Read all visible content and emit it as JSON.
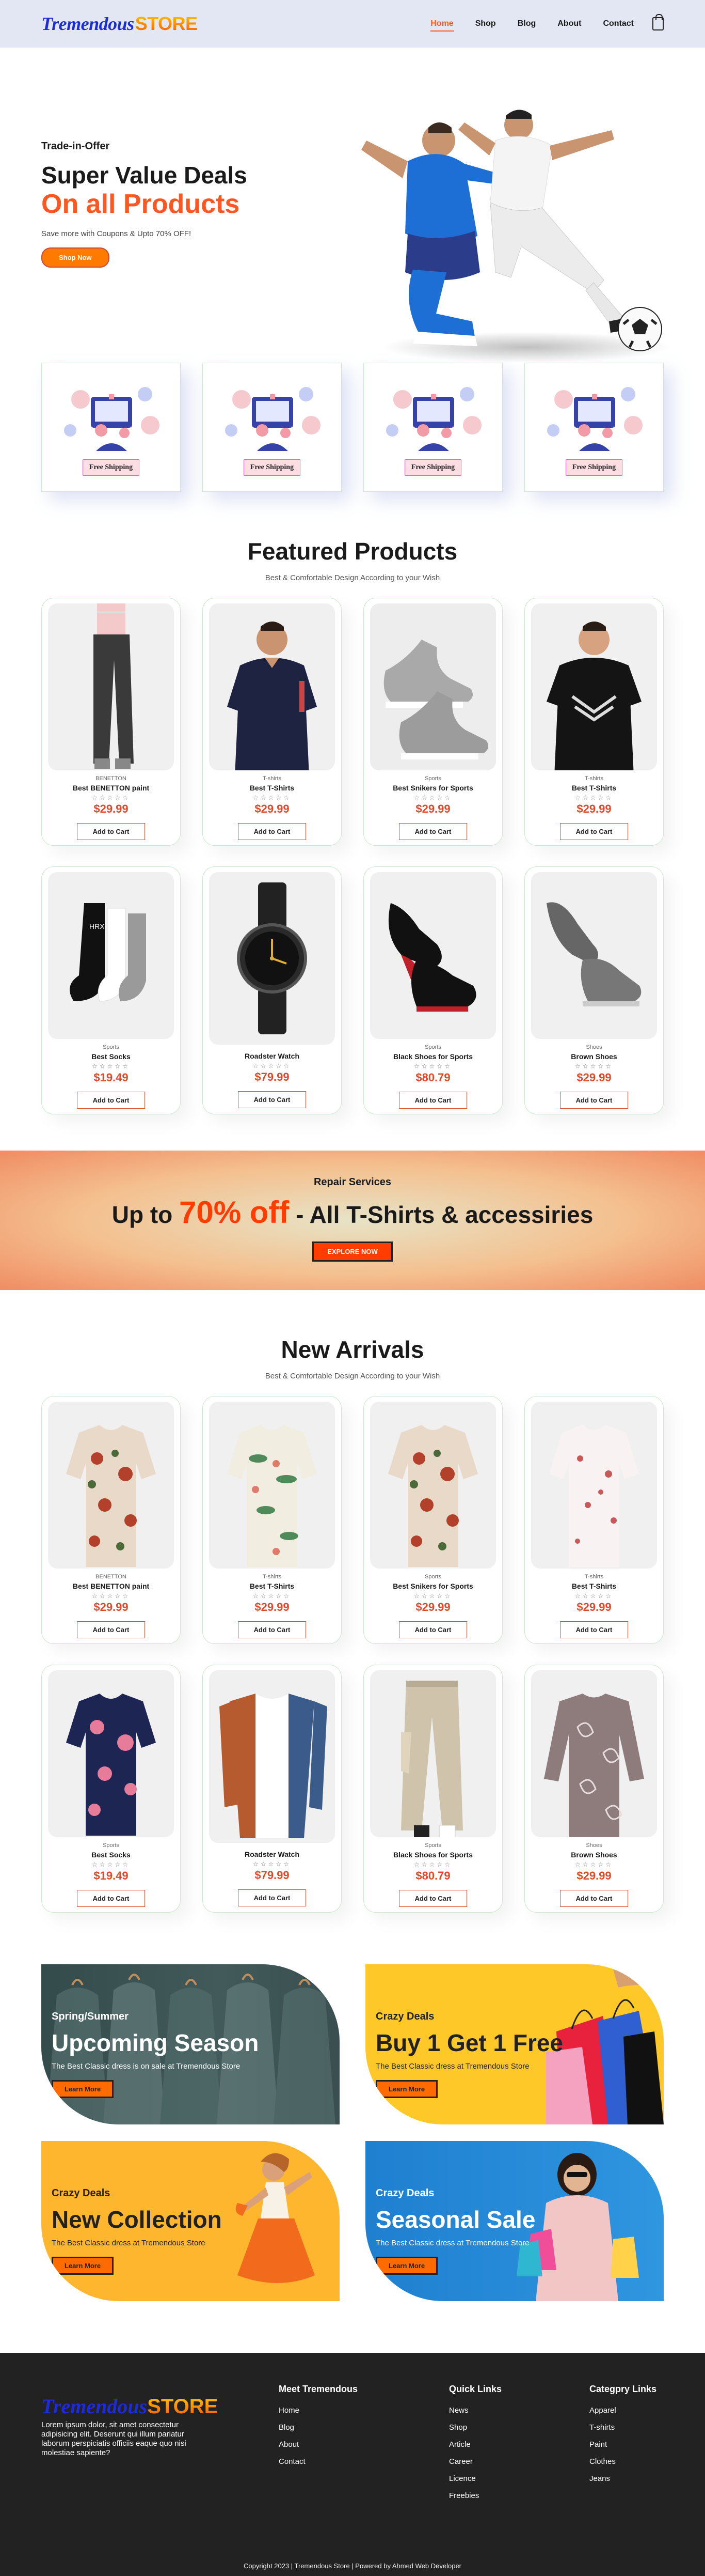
{
  "nav": {
    "logo_a": "Tremendous",
    "logo_b": "STORE",
    "links": [
      "Home",
      "Shop",
      "Blog",
      "About",
      "Contact"
    ],
    "active": "Home"
  },
  "hero": {
    "kicker": "Trade-in-Offer",
    "title": "Super Value Deals",
    "highlight": "On all Products",
    "subtitle": "Save more with Coupons & Upto 70% OFF!",
    "button": "Shop Now"
  },
  "features": [
    "Free Shipping",
    "Free Shipping",
    "Free Shipping",
    "Free Shipping"
  ],
  "featured": {
    "title": "Featured Products",
    "subtitle": "Best & Comfortable Design According to your Wish",
    "products": [
      {
        "brand": "BENETTON",
        "name": "Best BENETTON paint",
        "price": "$29.99",
        "img": "pants"
      },
      {
        "brand": "T-shirts",
        "name": "Best T-Shirts",
        "price": "$29.99",
        "img": "polo"
      },
      {
        "brand": "Sports",
        "name": "Best Snikers for Sports",
        "price": "$29.99",
        "img": "sneaker-grey"
      },
      {
        "brand": "T-shirts",
        "name": "Best T-Shirts",
        "price": "$29.99",
        "img": "tee-black"
      },
      {
        "brand": "Sports",
        "name": "Best Socks",
        "price": "$19.49",
        "img": "socks"
      },
      {
        "brand": "",
        "name": "Roadster Watch",
        "price": "$79.99",
        "img": "watch"
      },
      {
        "brand": "Sports",
        "name": "Black Shoes for Sports",
        "price": "$80.79",
        "img": "shoes-black"
      },
      {
        "brand": "Shoes",
        "name": "Brown Shoes",
        "price": "$29.99",
        "img": "shoe-grey"
      }
    ],
    "stars": "☆☆☆☆☆",
    "cart": "Add to Cart"
  },
  "banner": {
    "small": "Repair Services",
    "pre": "Up to ",
    "big": "70% off",
    "post": " - All T-Shirts & accessiries",
    "button": "EXPLORE NOW"
  },
  "arrivals": {
    "title": "New Arrivals",
    "subtitle": "Best & Comfortable Design According to your Wish",
    "products": [
      {
        "brand": "BENETTON",
        "name": "Best BENETTON paint",
        "price": "$29.99",
        "img": "shirt-floral-brown"
      },
      {
        "brand": "T-shirts",
        "name": "Best T-Shirts",
        "price": "$29.99",
        "img": "shirt-floral-green"
      },
      {
        "brand": "Sports",
        "name": "Best Snikers for Sports",
        "price": "$29.99",
        "img": "shirt-floral-brown"
      },
      {
        "brand": "T-shirts",
        "name": "Best T-Shirts",
        "price": "$29.99",
        "img": "shirt-floral-white"
      },
      {
        "brand": "Sports",
        "name": "Best Socks",
        "price": "$19.49",
        "img": "shirt-floral-navy"
      },
      {
        "brand": "",
        "name": "Roadster Watch",
        "price": "$79.99",
        "img": "shirt-rust-denim"
      },
      {
        "brand": "Sports",
        "name": "Black Shoes for Sports",
        "price": "$80.79",
        "img": "pants-beige"
      },
      {
        "brand": "Shoes",
        "name": "Brown Shoes",
        "price": "$29.99",
        "img": "top-paisley"
      }
    ],
    "stars": "☆☆☆☆☆",
    "cart": "Add to Cart"
  },
  "promos": [
    {
      "small": "Spring/Summer",
      "title": "Upcoming Season",
      "text": "The Best Classic dress is on sale at Tremendous Store",
      "button": "Learn More"
    },
    {
      "small": "Crazy Deals",
      "title": "Buy 1 Get 1 Free",
      "text": "The Best Classic dress at Tremendous Store",
      "button": "Learn More"
    },
    {
      "small": "Crazy Deals",
      "title": "New Collection",
      "text": "The Best Classic dress at Tremendous Store",
      "button": "Learn More"
    },
    {
      "small": "Crazy Deals",
      "title": "Seasonal Sale",
      "text": "The Best Classic dress at Tremendous Store",
      "button": "Learn More"
    }
  ],
  "footer": {
    "logo_a": "Tremendous",
    "logo_b": "STORE",
    "about": "Lorem ipsum dolor, sit amet consectetur adipisicing elit. Deserunt qui illum pariatur laborum perspiciatis officiis eaque quo nisi molestiae sapiente?",
    "col1": {
      "title": "Meet Tremendous",
      "links": [
        "Home",
        "Blog",
        "About",
        "Contact"
      ]
    },
    "col2": {
      "title": "Quick Links",
      "links": [
        "News",
        "Shop",
        "Article",
        "Career",
        "Licence",
        "Freebies"
      ]
    },
    "col3": {
      "title": "Categpry Links",
      "links": [
        "Apparel",
        "T-shirts",
        "Paint",
        "Clothes",
        "Jeans"
      ]
    },
    "copyright": "Copyright 2023 | Tremendous Store | Powered by Ahmed Web Developer"
  },
  "colors": {
    "accent": "#ff5722",
    "nav_bg": "#e3e6f3",
    "footer_bg": "#222222"
  }
}
